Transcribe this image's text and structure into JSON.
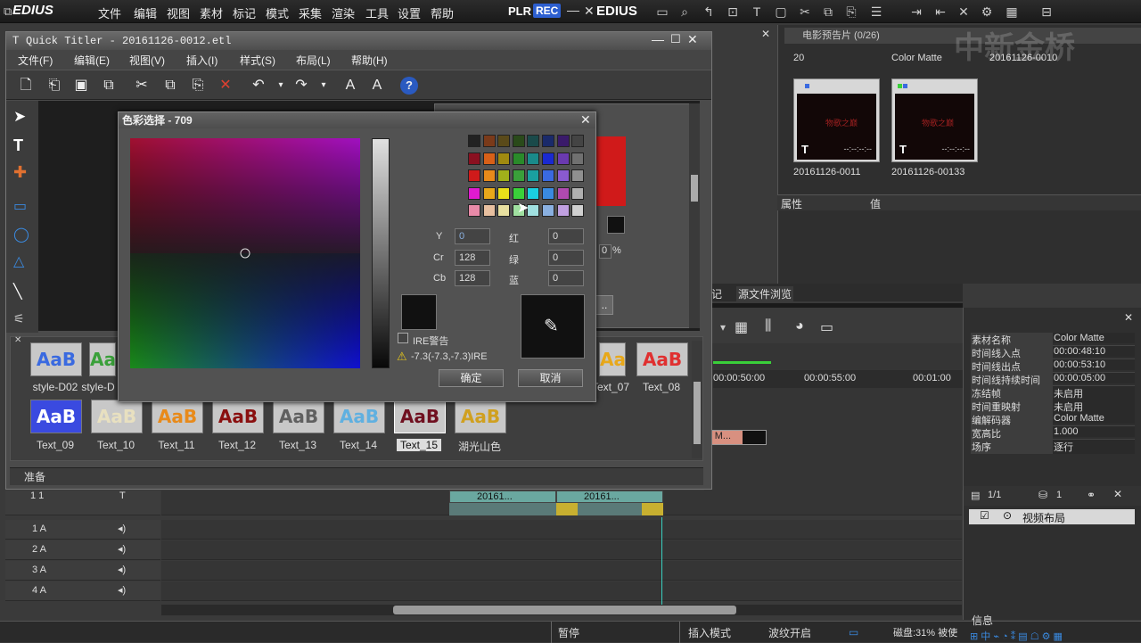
{
  "app": {
    "logo": "EDIUS",
    "menu": [
      "文件",
      "编辑",
      "视图",
      "素材",
      "标记",
      "模式",
      "采集",
      "渲染",
      "工具",
      "设置",
      "帮助"
    ],
    "plr": "PLR",
    "rec": "REC",
    "logo2": "EDIUS"
  },
  "bin": {
    "header": "电影预告片 (0/26)",
    "top_labels": [
      "20",
      "Color Matte",
      "20161126-0010"
    ],
    "clips": [
      {
        "label": "20161126-0011",
        "text": "物歌之巅",
        "time": "--:--:--:--"
      },
      {
        "label": "20161126-00133",
        "text": "物歌之巅",
        "time": "--:--:--:--"
      }
    ]
  },
  "props": {
    "col1": "属性",
    "col2": "值"
  },
  "quick_titler": {
    "title": "Quick Titler - 20161126-0012.etl",
    "menu": [
      "文件(F)",
      "编辑(E)",
      "视图(V)",
      "插入(I)",
      "样式(S)",
      "布局(L)",
      "帮助(H)"
    ],
    "styles_row1": [
      {
        "label": "style-D02",
        "text": "AaB"
      },
      {
        "label": "style-D",
        "text": "Aa"
      },
      {
        "label": "Text_07",
        "text": "AaB"
      },
      {
        "label": "Text_08",
        "text": "AaB"
      }
    ],
    "styles_row2": [
      {
        "label": "Text_09",
        "text": "AaB"
      },
      {
        "label": "Text_10",
        "text": "AaB"
      },
      {
        "label": "Text_11",
        "text": "AaB"
      },
      {
        "label": "Text_12",
        "text": "AaB"
      },
      {
        "label": "Text_13",
        "text": "AaB"
      },
      {
        "label": "Text_14",
        "text": "AaB"
      },
      {
        "label": "Text_15",
        "text": "AaB"
      },
      {
        "label": "湖光山色",
        "text": "AaB"
      }
    ],
    "status": "准备",
    "percent": "0",
    "percent_unit": "%"
  },
  "color_dialog": {
    "title": "色彩选择 - 709",
    "fields": [
      {
        "label": "Y",
        "value": "0"
      },
      {
        "label": "Cr",
        "value": "128"
      },
      {
        "label": "Cb",
        "value": "128"
      }
    ],
    "rgb": [
      {
        "label": "红",
        "value": "0"
      },
      {
        "label": "绿",
        "value": "0"
      },
      {
        "label": "蓝",
        "value": "0"
      }
    ],
    "ire_label": "IRE警告",
    "ire_value": "-7.3(-7.3,-7.3)IRE",
    "ok": "确定",
    "cancel": "取消",
    "palette": [
      [
        "#222222",
        "#7a3a1a",
        "#5a4a1a",
        "#2a4a1a",
        "#1a4a4a",
        "#1a2a6a",
        "#3a1a6a",
        "#444444"
      ],
      [
        "#8a1020",
        "#d86018",
        "#a08a10",
        "#2a8a2a",
        "#1a8a8a",
        "#1a2ad0",
        "#6a3ab0",
        "#707070"
      ],
      [
        "#d01a1a",
        "#e88a1a",
        "#a0b01a",
        "#3aa03a",
        "#1aa0a0",
        "#3a6ae0",
        "#8a5ad0",
        "#909090"
      ],
      [
        "#e01ad0",
        "#e8a81a",
        "#e8e01a",
        "#3ad03a",
        "#1ad0e0",
        "#3a8ae0",
        "#b04ab0",
        "#b0b0b0"
      ],
      [
        "#e88aa8",
        "#e8c0a0",
        "#e8e0a0",
        "#a0e0a0",
        "#a0e0e0",
        "#8ab0e0",
        "#c0a0e0",
        "#d0d0d0"
      ]
    ]
  },
  "timeline": {
    "times": [
      "00:00:50:00",
      "00:00:55:00",
      "00:01:00"
    ],
    "clip_text": [
      "20161...",
      "20161..."
    ],
    "clip_matte": "r M...",
    "tracks": [
      "1 A",
      "2 A",
      "3 A",
      "4 A"
    ],
    "track_top": "1 1",
    "tabs": [
      "记",
      "源文件浏览"
    ]
  },
  "clip_info": {
    "rows": [
      {
        "k": "素材名称",
        "v": "Color Matte"
      },
      {
        "k": "时间线入点",
        "v": "00:00:48:10"
      },
      {
        "k": "时间线出点",
        "v": "00:00:53:10"
      },
      {
        "k": "时间线持续时间",
        "v": "00:00:05:00"
      },
      {
        "k": "冻结帧",
        "v": "未启用"
      },
      {
        "k": "时间重映射",
        "v": "未启用"
      },
      {
        "k": "编解码器",
        "v": "Color Matte"
      },
      {
        "k": "宽高比",
        "v": "1.000"
      },
      {
        "k": "场序",
        "v": "逐行"
      }
    ],
    "count": "1/1",
    "count2": "1",
    "layout_item": "视频布局",
    "info_label": "信息"
  },
  "statusbar": {
    "pause": "暂停",
    "insert": "插入模式",
    "ripple": "波纹开启",
    "disk": "磁盘:31% 被使"
  },
  "watermark": "中新金桥"
}
